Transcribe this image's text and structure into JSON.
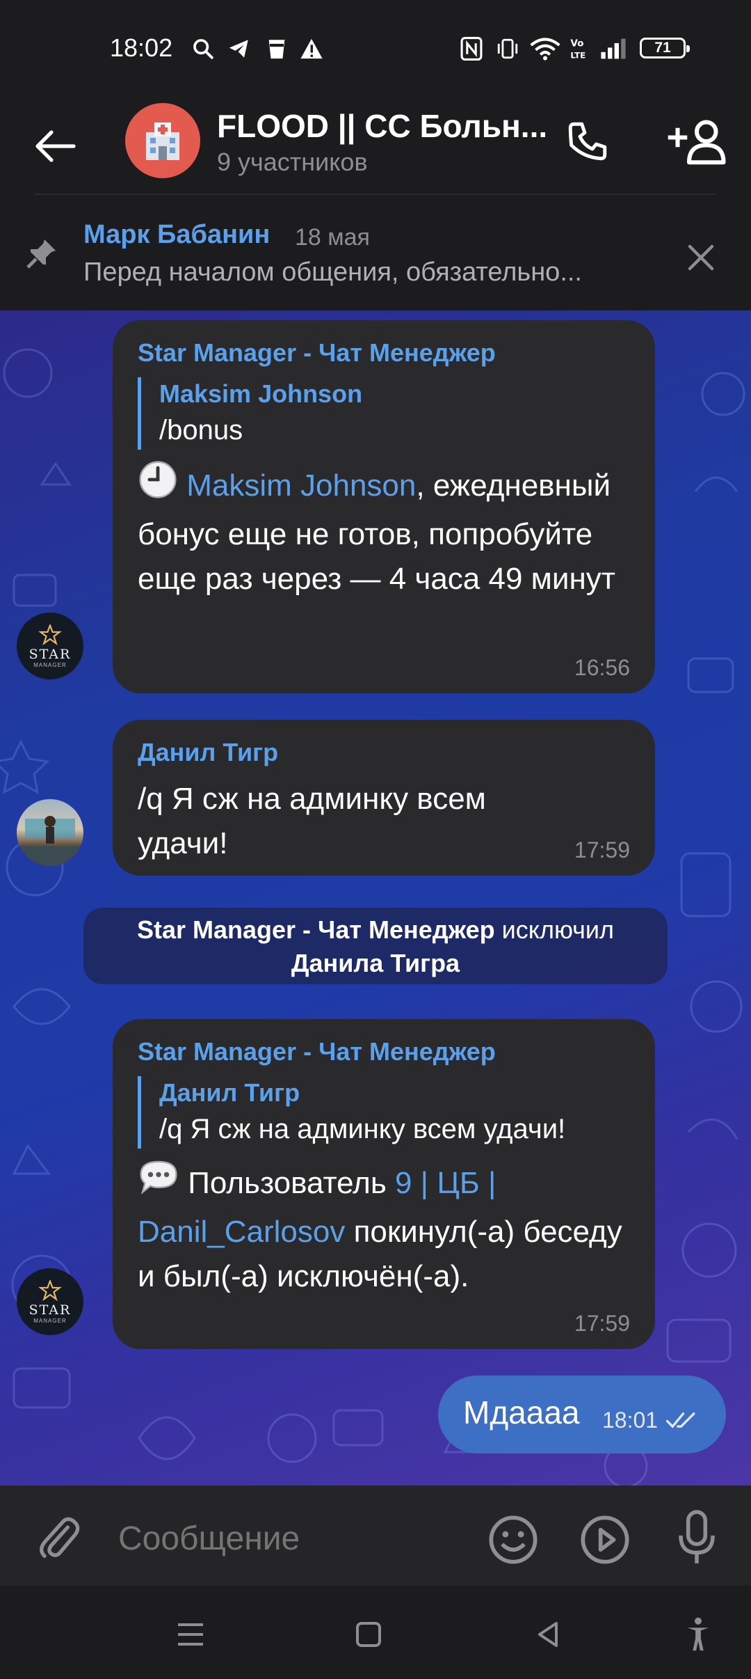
{
  "status_bar": {
    "time": "18:02",
    "battery": "71"
  },
  "header": {
    "title": "FLOOD || СС Больн...",
    "subtitle": "9 участников"
  },
  "pinned": {
    "author": "Марк Бабанин",
    "date": "18 мая",
    "text": "Перед началом общения, обязательно..."
  },
  "messages": [
    {
      "sender": "Star Manager - Чат Менеджер",
      "reply_author": "Maksim Johnson",
      "reply_text": "/bonus",
      "emoji": "clock",
      "mention": "Maksim Johnson",
      "text": ", ежедневный бонус еще не готов, попробуйте еще раз через — 4 часа 49 минут",
      "time": "16:56"
    },
    {
      "sender": "Данил Тигр",
      "text": "/q Я сж на админку всем удачи!",
      "time": "17:59"
    },
    {
      "service_actor": "Star Manager - Чат Менеджер",
      "service_action": " исключил ",
      "service_target": "Данила Тигра"
    },
    {
      "sender": "Star Manager - Чат Менеджер",
      "reply_author": "Данил Тигр",
      "reply_text": "/q Я сж на админку всем удачи!",
      "emoji": "speech-balloon",
      "text_prefix": " Пользователь ",
      "mention": "9 | ЦБ | Danil_Carlosov",
      "text_suffix": " покинул(-а) беседу и был(-а) исключён(-а).",
      "time": "17:59"
    },
    {
      "text": "Мдаааа",
      "time": "18:01",
      "status": "read"
    }
  ],
  "avatars": {
    "star_label": "STAR",
    "star_sub": "MANAGER"
  },
  "input": {
    "placeholder": "Сообщение"
  }
}
